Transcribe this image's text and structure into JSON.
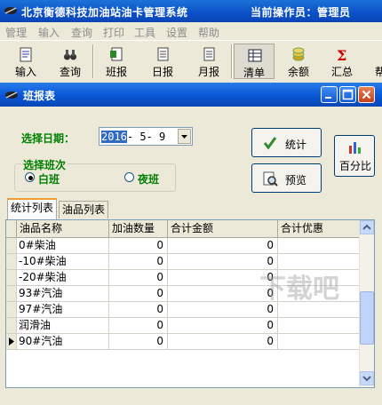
{
  "window": {
    "title": "北京衡德科技加油站油卡管理系统",
    "operator_text": "当前操作员：管理员"
  },
  "menu": [
    "管理",
    "输入",
    "查询",
    "打印",
    "工具",
    "设置",
    "帮助"
  ],
  "toolbar": [
    {
      "label": "输入",
      "icon": "notepad-icon"
    },
    {
      "label": "查询",
      "icon": "binoculars-icon"
    },
    {
      "label": "班报",
      "icon": "document-icon"
    },
    {
      "label": "日报",
      "icon": "document-icon"
    },
    {
      "label": "月报",
      "icon": "document-icon"
    },
    {
      "label": "清单",
      "icon": "list-icon"
    },
    {
      "label": "余额",
      "icon": "coins-icon"
    },
    {
      "label": "汇总",
      "icon": "sigma-icon"
    },
    {
      "label": "帮",
      "icon": "help-icon"
    }
  ],
  "report_window": {
    "title": "班报表",
    "date_label": "选择日期：",
    "date_year": "2016",
    "date_rest": "- 5- 9",
    "shift_group_label": "选择班次",
    "shift_day": "白班",
    "shift_night": "夜班",
    "selected_shift": "白班",
    "stats_button": "统计",
    "preview_button": "预览",
    "percent_button": "百分比",
    "tabs": [
      "统计列表",
      "油品列表"
    ],
    "active_tab": "统计列表",
    "columns": [
      "油品名称",
      "加油数量",
      "合计金额",
      "合计优惠"
    ],
    "rows": [
      {
        "name": "0#柴油",
        "qty": "0",
        "amount": "0"
      },
      {
        "name": "-10#柴油",
        "qty": "0",
        "amount": "0"
      },
      {
        "name": "-20#柴油",
        "qty": "0",
        "amount": "0"
      },
      {
        "name": "93#汽油",
        "qty": "0",
        "amount": "0"
      },
      {
        "name": "97#汽油",
        "qty": "0",
        "amount": "0"
      },
      {
        "name": "润滑油",
        "qty": "0",
        "amount": "0"
      },
      {
        "name": "90#汽油",
        "qty": "0",
        "amount": "0"
      }
    ]
  },
  "watermark": "下载吧"
}
